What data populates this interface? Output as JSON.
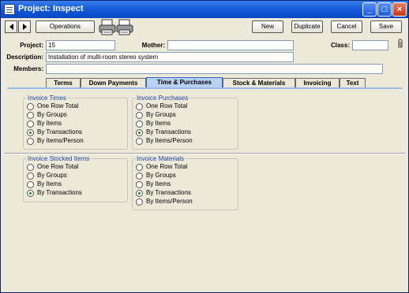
{
  "window": {
    "title": "Project: Inspect"
  },
  "toolbar": {
    "operations_label": "Operations",
    "new_label": "New",
    "duplicate_label": "Duplicate",
    "cancel_label": "Cancel",
    "save_label": "Save"
  },
  "header": {
    "project_label": "Project:",
    "project_value": "15",
    "mother_label": "Mother:",
    "mother_value": "",
    "class_label": "Class:",
    "class_value": "",
    "description_label": "Description:",
    "description_value": "Installation of multi-room stereo system",
    "members_label": "Members:",
    "members_value": ""
  },
  "tabs": [
    {
      "label": "Terms",
      "active": false
    },
    {
      "label": "Down Payments",
      "active": false
    },
    {
      "label": "Time & Purchases",
      "active": true
    },
    {
      "label": "Stock & Materials",
      "active": false
    },
    {
      "label": "Invoicing",
      "active": false
    },
    {
      "label": "Text",
      "active": false
    }
  ],
  "groups": {
    "invoice_times": {
      "title": "Invoice Times",
      "options": [
        "One Row Total",
        "By Groups",
        "By Items",
        "By Transactions",
        "By Items/Person"
      ],
      "selected": "By Transactions"
    },
    "invoice_purchases": {
      "title": "Invoice Purchases",
      "options": [
        "One Row Total",
        "By Groups",
        "By Items",
        "By Transactions",
        "By Items/Person"
      ],
      "selected": "By Transactions"
    },
    "invoice_stocked_items": {
      "title": "Invoice Stocked Items",
      "options": [
        "One Row Total",
        "By Groups",
        "By Items",
        "By Transactions"
      ],
      "selected": "By Transactions"
    },
    "invoice_materials": {
      "title": "Invoice Materials",
      "options": [
        "One Row Total",
        "By Groups",
        "By Items",
        "By Transactions",
        "By Items/Person"
      ],
      "selected": "By Transactions"
    }
  },
  "colors": {
    "title_bar": "#0d4fcf",
    "active_tab": "#b9d1f3",
    "group_title": "#1c3fa8",
    "radio_selected": "#1f8a1f"
  },
  "icons": [
    "app-icon",
    "minimize-icon",
    "maximize-icon",
    "close-icon",
    "prev-arrow-icon",
    "next-arrow-icon",
    "printer-icon",
    "paperclip-icon"
  ]
}
